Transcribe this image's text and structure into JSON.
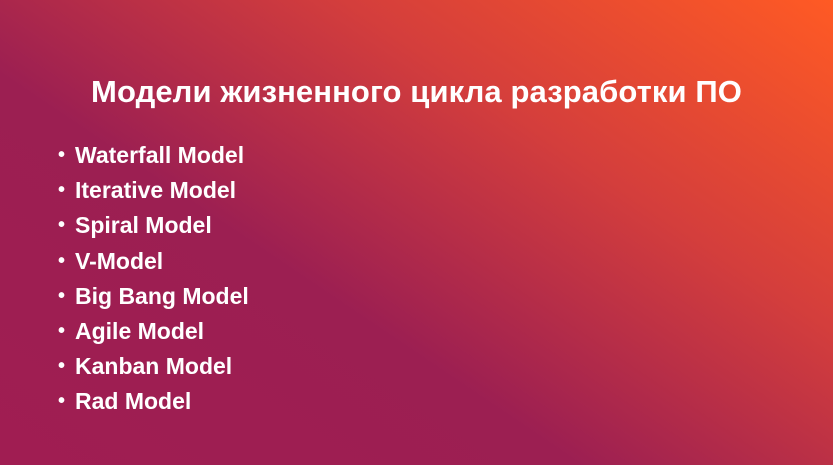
{
  "slide": {
    "title": "Модели жизненного цикла разработки ПО",
    "bullet_glyph": "•",
    "models": [
      "Waterfall Model",
      "Iterative Model",
      "Spiral Model",
      "V-Model",
      "Big Bang Model",
      "Agile Model",
      "Kanban Model",
      "Rad Model"
    ]
  },
  "colors": {
    "gradient_start": "#a01d52",
    "gradient_mid": "#d43e3c",
    "gradient_end": "#ff5a24",
    "text": "#ffffff"
  }
}
